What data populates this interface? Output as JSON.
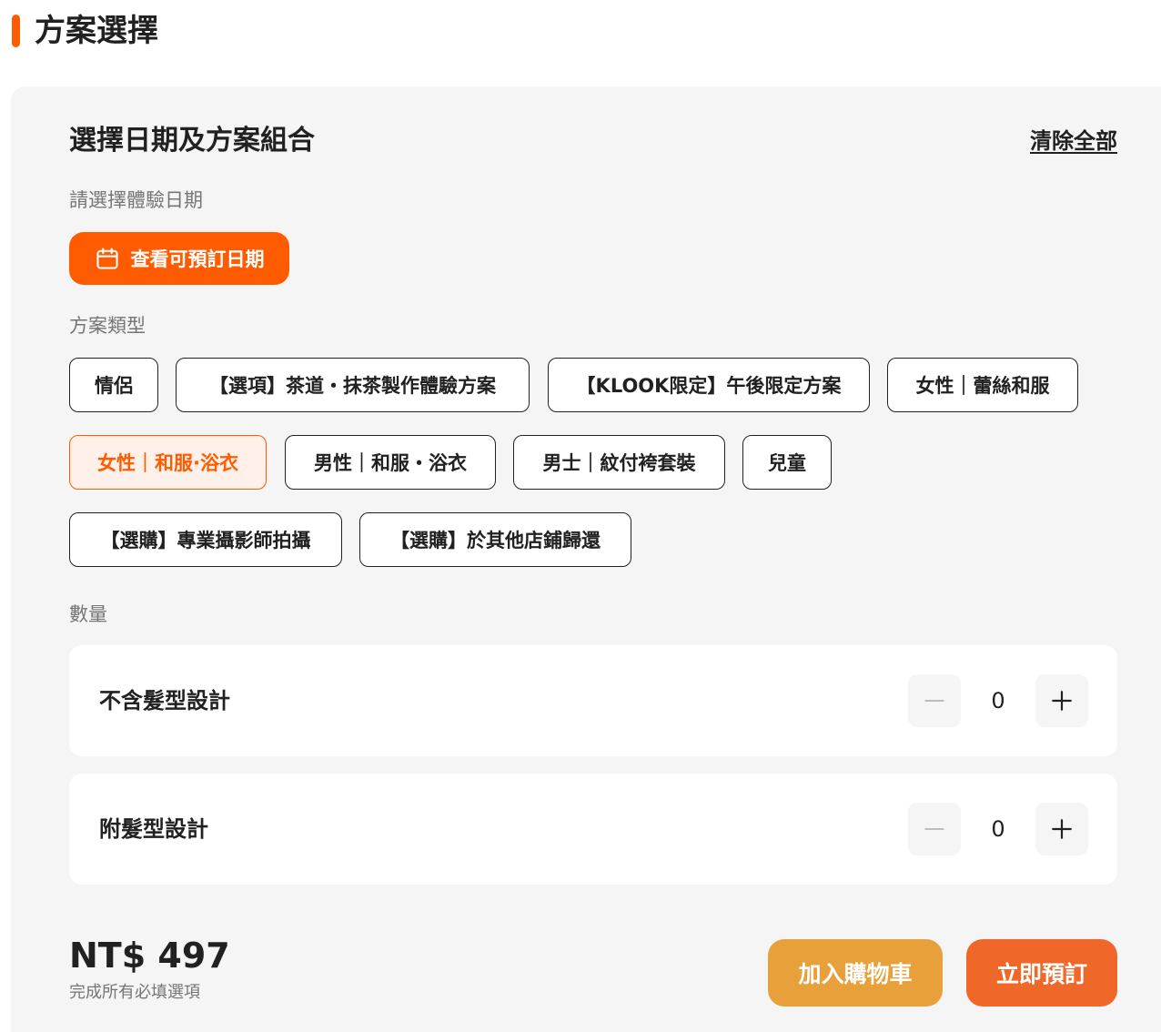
{
  "section": {
    "title": "方案選擇"
  },
  "panel": {
    "title": "選擇日期及方案組合",
    "clear_all": "清除全部"
  },
  "date": {
    "label": "請選擇體驗日期",
    "button_label": "查看可預訂日期",
    "button_icon": "calendar-icon"
  },
  "package_type": {
    "label": "方案類型",
    "options": [
      {
        "label": "情侶",
        "selected": false
      },
      {
        "label": "【選項】茶道・抹茶製作體驗方案",
        "selected": false
      },
      {
        "label": "【KLOOK限定】午後限定方案",
        "selected": false
      },
      {
        "label": "女性｜蕾絲和服",
        "selected": false
      },
      {
        "label": "女性｜和服·浴衣",
        "selected": true
      },
      {
        "label": "男性｜和服・浴衣",
        "selected": false
      },
      {
        "label": "男士｜紋付袴套裝",
        "selected": false
      },
      {
        "label": "兒童",
        "selected": false
      },
      {
        "label": "【選購】專業攝影師拍攝",
        "selected": false
      },
      {
        "label": "【選購】於其他店鋪歸還",
        "selected": false
      }
    ]
  },
  "quantity": {
    "label": "數量",
    "items": [
      {
        "label": "不含髮型設計",
        "value": "0"
      },
      {
        "label": "附髮型設計",
        "value": "0"
      }
    ]
  },
  "footer": {
    "price": "NT$ 497",
    "note": "完成所有必填選項",
    "add_to_cart": "加入購物車",
    "book_now": "立即預訂"
  },
  "colors": {
    "accent": "#ff5b00",
    "selected_bg": "#fff1ea",
    "cart_button": "#e8a13a",
    "book_button": "#f0672a"
  }
}
